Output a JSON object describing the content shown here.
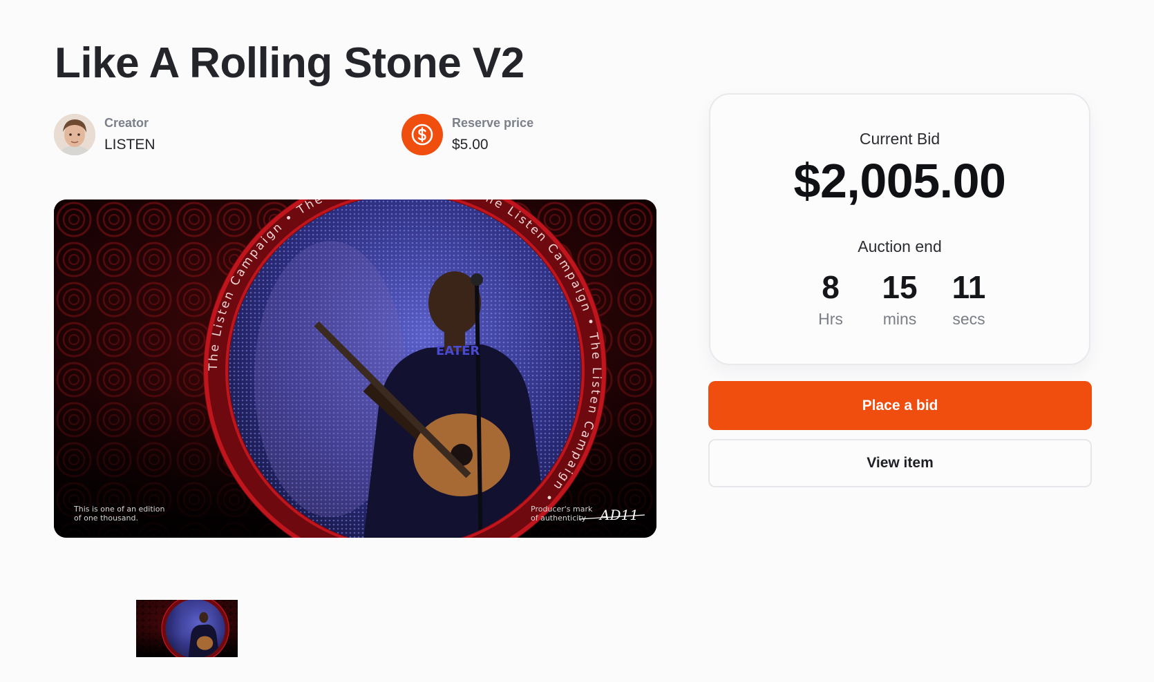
{
  "item": {
    "title": "Like A Rolling Stone V2"
  },
  "creator": {
    "label": "Creator",
    "name": "LISTEN"
  },
  "reserve": {
    "label": "Reserve price",
    "value": "$5.00",
    "icon": "dollar-coin-icon"
  },
  "media": {
    "edition_note": "This is one of an edition\nof one thousand.",
    "producer_note": "Producer's mark\nof authenticity",
    "signature": "AD11",
    "ring_text": "The Listen Campaign • The Listen Campaign • The Listen Campaign • The Listen Campaign •"
  },
  "bid": {
    "current_label": "Current Bid",
    "amount": "$2,005.00",
    "end_label": "Auction end",
    "countdown": [
      {
        "value": "8",
        "unit": "Hrs"
      },
      {
        "value": "15",
        "unit": "mins"
      },
      {
        "value": "11",
        "unit": "secs"
      }
    ]
  },
  "actions": {
    "place_bid": "Place a bid",
    "view_item": "View item"
  },
  "colors": {
    "accent": "#f04e0f",
    "ring": "#b3121b"
  }
}
